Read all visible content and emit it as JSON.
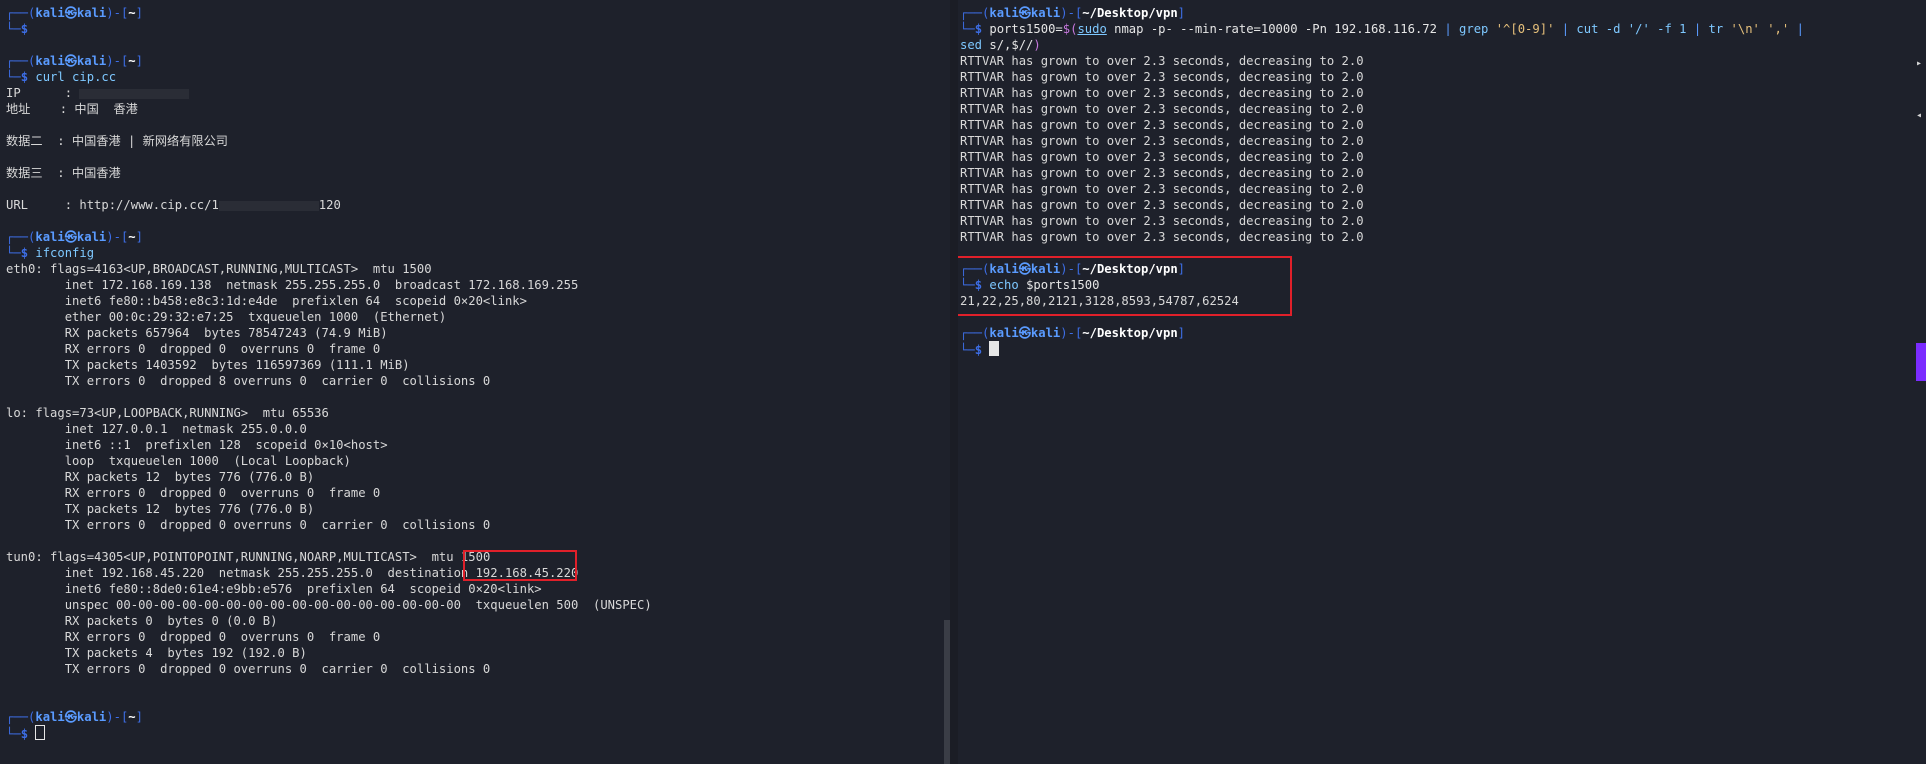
{
  "left_terminal": {
    "user": "kali",
    "host": "kali",
    "cwd": "~",
    "lines": {
      "curl_cmd": "curl cip.cc",
      "ip_label": "IP      : ",
      "addr": "地址    : 中国  香港",
      "data2": "数据二  : 中国香港 | 新网络有限公司",
      "data3": "数据三  : 中国香港",
      "url": "URL     : http://www.cip.cc/1",
      "url_tail": "120",
      "ifconfig_cmd": "ifconfig",
      "eth0_1": "eth0: flags=4163<UP,BROADCAST,RUNNING,MULTICAST>  mtu 1500",
      "eth0_2": "        inet 172.168.169.138  netmask 255.255.255.0  broadcast 172.168.169.255",
      "eth0_3": "        inet6 fe80::b458:e8c3:1d:e4de  prefixlen 64  scopeid 0×20<link>",
      "eth0_4": "        ether 00:0c:29:32:e7:25  txqueuelen 1000  (Ethernet)",
      "eth0_5": "        RX packets 657964  bytes 78547243 (74.9 MiB)",
      "eth0_6": "        RX errors 0  dropped 0  overruns 0  frame 0",
      "eth0_7": "        TX packets 1403592  bytes 116597369 (111.1 MiB)",
      "eth0_8": "        TX errors 0  dropped 8 overruns 0  carrier 0  collisions 0",
      "lo_1": "lo: flags=73<UP,LOOPBACK,RUNNING>  mtu 65536",
      "lo_2": "        inet 127.0.0.1  netmask 255.0.0.0",
      "lo_3": "        inet6 ::1  prefixlen 128  scopeid 0×10<host>",
      "lo_4": "        loop  txqueuelen 1000  (Local Loopback)",
      "lo_5": "        RX packets 12  bytes 776 (776.0 B)",
      "lo_6": "        RX errors 0  dropped 0  overruns 0  frame 0",
      "lo_7": "        TX packets 12  bytes 776 (776.0 B)",
      "lo_8": "        TX errors 0  dropped 0 overruns 0  carrier 0  collisions 0",
      "tun0_1a": "tun0: flags=4305<UP,POINTOPOINT,RUNNING,NOARP,MULTICAST>  ",
      "tun0_1b": "mtu 1500",
      "tun0_2": "        inet 192.168.45.220  netmask 255.255.255.0  destination 192.168.45.220",
      "tun0_3": "        inet6 fe80::8de0:61e4:e9bb:e576  prefixlen 64  scopeid 0×20<link>",
      "tun0_4": "        unspec 00-00-00-00-00-00-00-00-00-00-00-00-00-00-00-00  txqueuelen 500  (UNSPEC)",
      "tun0_5": "        RX packets 0  bytes 0 (0.0 B)",
      "tun0_6": "        RX errors 0  dropped 0  overruns 0  frame 0",
      "tun0_7": "        TX packets 4  bytes 192 (192.0 B)",
      "tun0_8": "        TX errors 0  dropped 0 overruns 0  carrier 0  collisions 0"
    }
  },
  "right_terminal": {
    "user": "kali",
    "host": "kali",
    "cwd": "~/Desktop/vpn",
    "nmap_cmd": {
      "assign": "ports1500=",
      "sub_open": "$(",
      "sudo": "sudo",
      "nmap": " nmap -p- --min-rate=10000 -Pn 192.168.116.72 ",
      "pipe1": "| ",
      "grep": "grep ",
      "grep_arg": "'^[0-9]'",
      "pipe2": " | ",
      "cut": "cut -d '/' -f 1 ",
      "pipe3": "| ",
      "tr": "tr ",
      "tr_arg": "'\\n' ','",
      "pipe4": " |",
      "sed": "sed",
      "sed_arg": " s/,$//",
      "sub_close": ")"
    },
    "rttvar_line": "RTTVAR has grown to over 2.3 seconds, decreasing to 2.0",
    "rttvar_count": 12,
    "echo_cmd": "echo",
    "echo_arg": " $ports1500",
    "ports_output": "21,22,25,80,2121,3128,8593,54787,62524"
  },
  "prompt": {
    "open": "┌──(",
    "at": "㉿",
    "close": ")-[",
    "end": "]",
    "dollar_prefix": "└─",
    "dollar": "$ "
  },
  "colors": {
    "background": "#1e212b",
    "prompt_blue": "#3d6ee6",
    "highlight_red": "#e0202a",
    "scroll_accent": "#7b2cff"
  }
}
